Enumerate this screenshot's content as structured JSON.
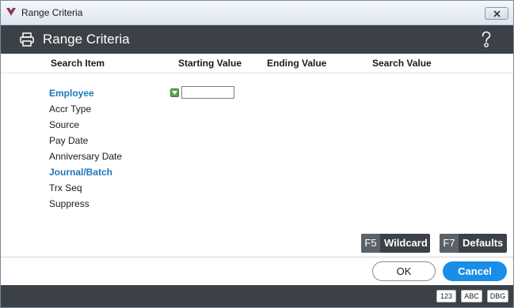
{
  "window": {
    "title": "Range Criteria"
  },
  "header": {
    "title": "Range Criteria"
  },
  "columns": [
    "Search Item",
    "Starting Value",
    "Ending Value",
    "Search Value"
  ],
  "items": [
    {
      "label": "Employee",
      "link": true
    },
    {
      "label": "Accr Type",
      "link": false
    },
    {
      "label": "Source",
      "link": false
    },
    {
      "label": "Pay Date",
      "link": false
    },
    {
      "label": "Anniversary Date",
      "link": false
    },
    {
      "label": "Journal/Batch",
      "link": true
    },
    {
      "label": "Trx Seq",
      "link": false
    },
    {
      "label": "Suppress",
      "link": false
    }
  ],
  "employee_start_value": "",
  "function_buttons": [
    {
      "key": "F5",
      "label": "Wildcard"
    },
    {
      "key": "F7",
      "label": "Defaults"
    }
  ],
  "dialog_buttons": {
    "ok": "OK",
    "cancel": "Cancel"
  },
  "status_buttons": [
    "123",
    "ABC",
    "DBG"
  ],
  "colors": {
    "header_bg": "#3c4147",
    "link_text": "#1d77b9",
    "primary_button": "#1a8ee6",
    "lookup_icon": "#58a84a"
  }
}
